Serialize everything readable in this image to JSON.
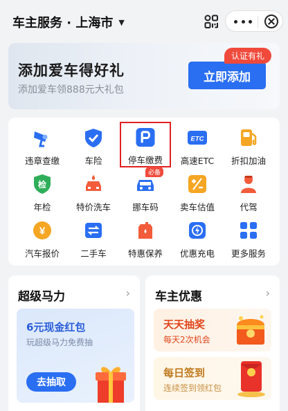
{
  "header": {
    "title": "车主服务 · 上海市",
    "caret": "▼"
  },
  "banner": {
    "title": "添加爱车得好礼",
    "subtitle": "添加爱车领888元大礼包",
    "button": "立即添加",
    "badge": "认证有礼"
  },
  "services": [
    {
      "label": "违章查缴",
      "icon": "camera-icon"
    },
    {
      "label": "车险",
      "icon": "shield-check-icon"
    },
    {
      "label": "停车缴费",
      "icon": "parking-icon",
      "highlighted": true
    },
    {
      "label": "高速ETC",
      "icon": "etc-icon",
      "icon_text": "ETC"
    },
    {
      "label": "折扣加油",
      "icon": "gas-pump-icon"
    },
    {
      "label": "年检",
      "icon": "inspection-badge-icon",
      "icon_text": "检"
    },
    {
      "label": "特价洗车",
      "icon": "car-wash-icon"
    },
    {
      "label": "挪车码",
      "icon": "move-car-icon",
      "badge": "必备"
    },
    {
      "label": "卖车估值",
      "icon": "valuation-icon"
    },
    {
      "label": "代驾",
      "icon": "chauffeur-icon"
    },
    {
      "label": "汽车报价",
      "icon": "yuan-tag-icon",
      "icon_text": "¥"
    },
    {
      "label": "二手车",
      "icon": "used-car-icon"
    },
    {
      "label": "特惠保养",
      "icon": "oil-can-icon"
    },
    {
      "label": "优惠充电",
      "icon": "charging-icon"
    },
    {
      "label": "更多服务",
      "icon": "grid-more-icon"
    }
  ],
  "cards": {
    "left": {
      "title": "超级马力",
      "arrow": "›",
      "promo": {
        "title": "6元现金红包",
        "subtitle": "玩超级马力免费抽",
        "button": "去抽取"
      }
    },
    "right": {
      "title": "车主优惠",
      "arrow": "›",
      "promos": [
        {
          "title": "天天抽奖",
          "subtitle": "每天2次机会"
        },
        {
          "title": "每日签到",
          "subtitle": "连续签到领红包"
        }
      ]
    }
  },
  "colors": {
    "accent": "#2a6ef2",
    "highlight_border": "#e02020",
    "badge": "#f04a3c",
    "background": "#f2f3f5"
  }
}
